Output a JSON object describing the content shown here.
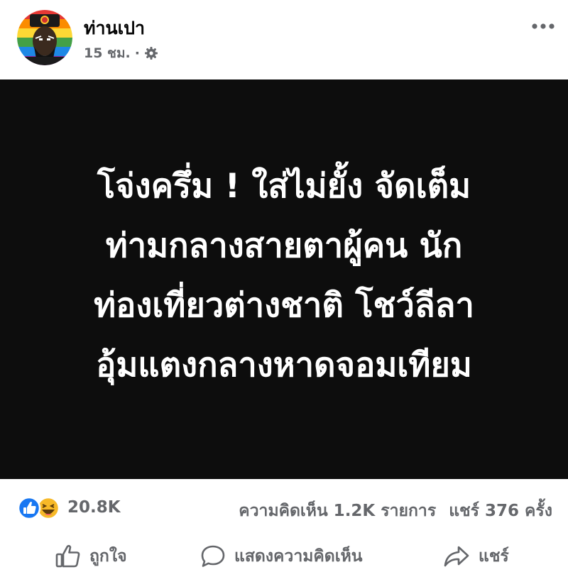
{
  "post": {
    "author": "ท่านเปา",
    "time": "15 ชม.",
    "meta_separator": "·",
    "audience_icon": "gear-icon",
    "more_icon": "more-icon"
  },
  "image": {
    "headline_lines": [
      "โจ่งครึ่ม ! ใส่ไม่ยั้ง จัดเต็ม",
      "ท่ามกลางสายตาผู้คน นัก",
      "ท่องเที่ยวต่างชาติ โชว์ลีลา",
      "อุ้มแตงกลางหาดจอมเทียม"
    ],
    "background": "#0d0d0d",
    "text_color": "#ffffff"
  },
  "stats": {
    "reaction_icons": [
      "like-reaction-icon",
      "haha-reaction-icon"
    ],
    "reaction_count": "20.8K",
    "comments": "ความคิดเห็น 1.2K รายการ",
    "shares": "แชร์ 376 ครั้ง"
  },
  "actions": {
    "like_label": "ถูกใจ",
    "comment_label": "แสดงความคิดเห็น",
    "share_label": "แชร์"
  },
  "colors": {
    "secondary_text": "#65676b",
    "like_blue": "#1877f2",
    "haha_yellow": "#f7b928"
  }
}
